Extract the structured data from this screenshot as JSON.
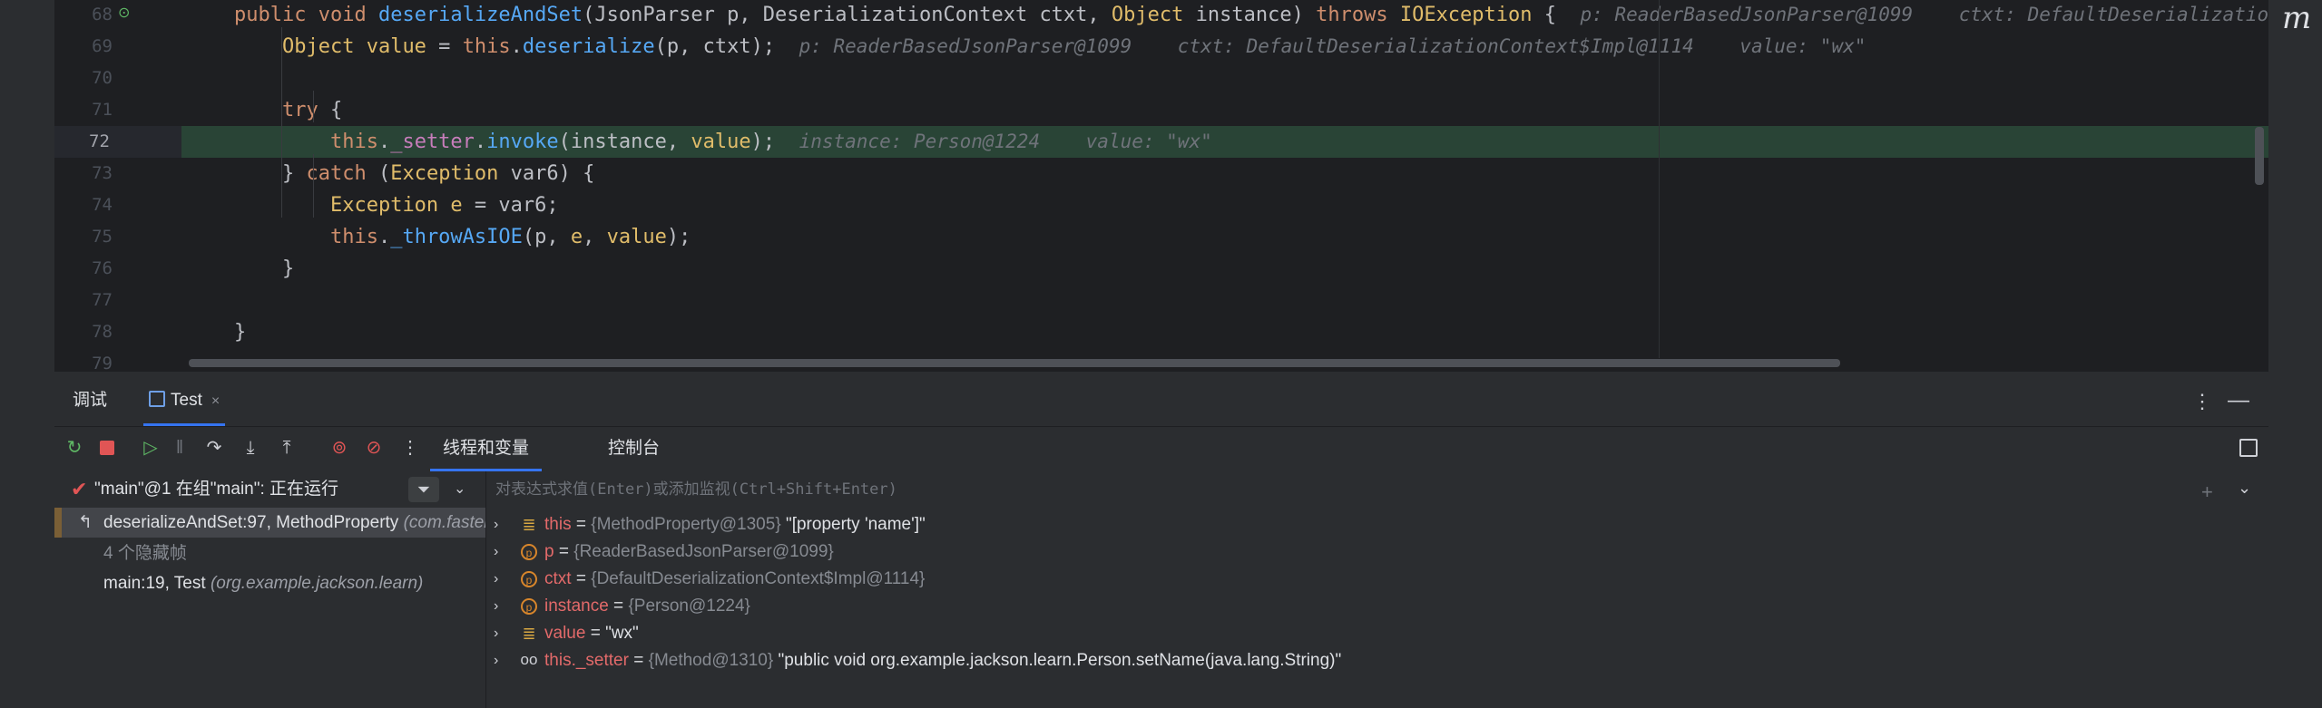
{
  "editor": {
    "lines": [
      {
        "num": "68",
        "segments": [
          {
            "t": "public ",
            "c": "kw"
          },
          {
            "t": "void ",
            "c": "kw"
          },
          {
            "t": "deserializeAndSet",
            "c": "fn"
          },
          {
            "t": "(JsonParser p, DeserializationContext ctxt, ",
            "c": "ty"
          },
          {
            "t": "Object",
            "c": "varh"
          },
          {
            "t": " instance) ",
            "c": "ty"
          },
          {
            "t": "throws ",
            "c": "kw"
          },
          {
            "t": "IOException",
            "c": "varh"
          },
          {
            "t": " {  ",
            "c": "ty"
          },
          {
            "t": "p: ReaderBasedJsonParser@1099    ctxt: DefaultDeserializatio",
            "c": "ann"
          }
        ]
      },
      {
        "num": "69",
        "segments": [
          {
            "t": "    "
          },
          {
            "t": "Object ",
            "c": "varh"
          },
          {
            "t": "value",
            "c": "varh"
          },
          {
            "t": " = ",
            "c": "ty"
          },
          {
            "t": "this",
            "c": "kw"
          },
          {
            "t": ".",
            "c": "ty"
          },
          {
            "t": "deserialize",
            "c": "fn"
          },
          {
            "t": "(p, ctxt);  ",
            "c": "ty"
          },
          {
            "t": "p: ReaderBasedJsonParser@1099    ctxt: DefaultDeserializationContext$Impl@1114    value: \"wx\"",
            "c": "ann"
          }
        ]
      },
      {
        "num": "70",
        "segments": []
      },
      {
        "num": "71",
        "segments": [
          {
            "t": "    "
          },
          {
            "t": "try",
            "c": "kw"
          },
          {
            "t": " {",
            "c": "ty"
          }
        ]
      },
      {
        "num": "72",
        "segments": [
          {
            "t": "        "
          },
          {
            "t": "this",
            "c": "kw"
          },
          {
            "t": ".",
            "c": "ty"
          },
          {
            "t": "_setter",
            "c": "fld"
          },
          {
            "t": ".",
            "c": "ty"
          },
          {
            "t": "invoke",
            "c": "fn"
          },
          {
            "t": "(instance, ",
            "c": "ty"
          },
          {
            "t": "value",
            "c": "varh"
          },
          {
            "t": ");  ",
            "c": "ty"
          },
          {
            "t": "instance: Person@1224    value: \"wx\"",
            "c": "ann"
          }
        ]
      },
      {
        "num": "73",
        "segments": [
          {
            "t": "    "
          },
          {
            "t": "} ",
            "c": "ty"
          },
          {
            "t": "catch",
            "c": "kw"
          },
          {
            "t": " (",
            "c": "ty"
          },
          {
            "t": "Exception",
            "c": "varh"
          },
          {
            "t": " var6) {",
            "c": "ty"
          }
        ]
      },
      {
        "num": "74",
        "segments": [
          {
            "t": "        "
          },
          {
            "t": "Exception ",
            "c": "varh"
          },
          {
            "t": "e",
            "c": "varh"
          },
          {
            "t": " = var6;",
            "c": "ty"
          }
        ]
      },
      {
        "num": "75",
        "segments": [
          {
            "t": "        "
          },
          {
            "t": "this",
            "c": "kw"
          },
          {
            "t": ".",
            "c": "ty"
          },
          {
            "t": "_throwAsIOE",
            "c": "fn"
          },
          {
            "t": "(p, ",
            "c": "ty"
          },
          {
            "t": "e",
            "c": "varh"
          },
          {
            "t": ", ",
            "c": "ty"
          },
          {
            "t": "value",
            "c": "varh"
          },
          {
            "t": ");",
            "c": "ty"
          }
        ]
      },
      {
        "num": "76",
        "segments": [
          {
            "t": "    "
          },
          {
            "t": "}",
            "c": "ty"
          }
        ]
      },
      {
        "num": "77",
        "segments": []
      },
      {
        "num": "78",
        "segments": [
          {
            "t": "}",
            "c": "ty"
          }
        ]
      },
      {
        "num": "79",
        "segments": []
      }
    ],
    "highlighted_line": "72",
    "right_marker": "m"
  },
  "debug": {
    "tab_debug": "调试",
    "tab_test": "Test",
    "tab_close": "×",
    "subtab_threads": "线程和变量",
    "subtab_console": "控制台",
    "thread_label": "\"main\"@1 在组\"main\": 正在运行",
    "frames": [
      {
        "method": "deserializeAndSet:97, MethodProperty",
        "pkg": "(com.fasterxml"
      },
      {
        "method": "main:19, Test",
        "pkg": "(org.example.jackson.learn)"
      }
    ],
    "hidden_frames": "4 个隐藏帧",
    "eval_placeholder": "对表达式求值(Enter)或添加监视(Ctrl+Shift+Enter)",
    "variables": [
      {
        "name": "this",
        "eq": " = ",
        "type": "{MethodProperty@1305} ",
        "value": "\"[property 'name']\"",
        "icon": "field"
      },
      {
        "name": "p",
        "eq": " = ",
        "type": "{ReaderBasedJsonParser@1099}",
        "value": "",
        "icon": "param"
      },
      {
        "name": "ctxt",
        "eq": " = ",
        "type": "{DefaultDeserializationContext$Impl@1114}",
        "value": "",
        "icon": "param"
      },
      {
        "name": "instance",
        "eq": " = ",
        "type": "{Person@1224}",
        "value": "",
        "icon": "param"
      },
      {
        "name": "value",
        "eq": " = ",
        "type": "",
        "value": "\"wx\"",
        "icon": "field"
      },
      {
        "name": "this._setter",
        "eq": " = ",
        "type": "{Method@1310} ",
        "value": "\"public void org.example.jackson.learn.Person.setName(java.lang.String)\"",
        "icon": "watch"
      }
    ]
  },
  "colors": {
    "accent": "#3574f0",
    "highlight": "#294436",
    "keyword": "#cf8e6d",
    "function": "#56a8f5"
  }
}
